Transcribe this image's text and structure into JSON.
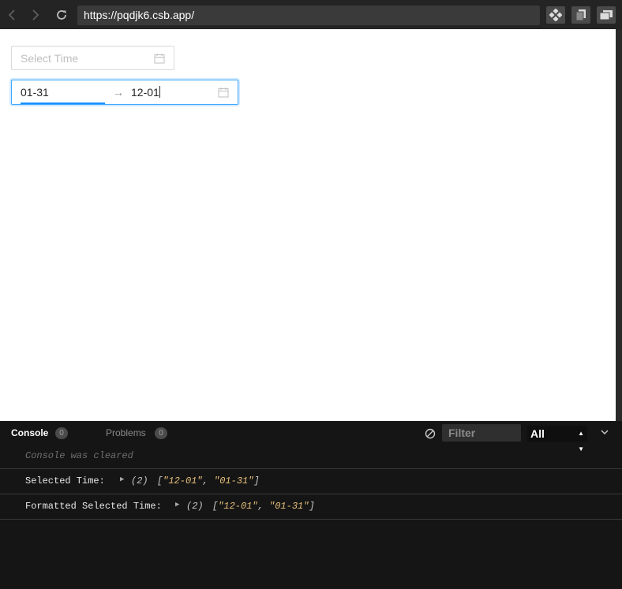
{
  "browser": {
    "url": "https://pqdjk6.csb.app/"
  },
  "page": {
    "single_picker": {
      "placeholder": "Select Time"
    },
    "range_picker": {
      "start": "01-31",
      "separator": "→",
      "end": "12-01"
    }
  },
  "console": {
    "tabs": [
      {
        "label": "Console",
        "count": "0",
        "active": true
      },
      {
        "label": "Problems",
        "count": "0",
        "active": false
      }
    ],
    "filter_placeholder": "Filter",
    "level": "All",
    "cleared_message": "Console was cleared",
    "logs": [
      {
        "label": "Selected Time:",
        "count": "(2)",
        "values": [
          "12-01",
          "01-31"
        ]
      },
      {
        "label": "Formatted Selected Time:",
        "count": "(2)",
        "values": [
          "12-01",
          "01-31"
        ]
      }
    ]
  },
  "colors": {
    "accent": "#1890ff",
    "string": "#e8c07a",
    "console_bg": "#151515"
  }
}
